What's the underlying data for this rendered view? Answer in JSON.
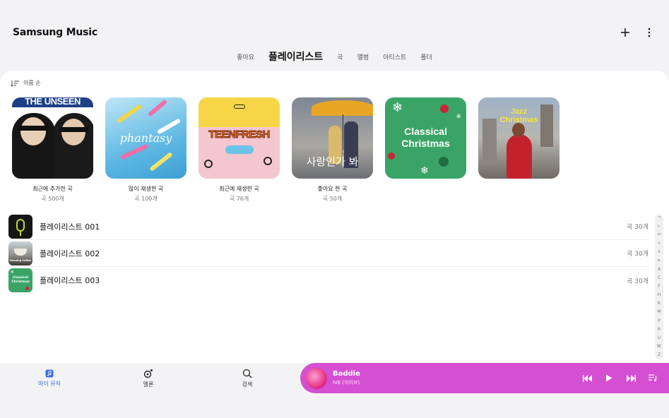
{
  "app": {
    "title": "Samsung Music"
  },
  "tabs": [
    {
      "label": "좋아요"
    },
    {
      "label": "플레이리스트",
      "active": true
    },
    {
      "label": "곡"
    },
    {
      "label": "앨범"
    },
    {
      "label": "아티스트"
    },
    {
      "label": "폴더"
    }
  ],
  "sort": {
    "label": "이름 순"
  },
  "featured": [
    {
      "title": "최근에 추가한 곡",
      "count": "곡 500개",
      "cover_text": "THE UNSEEN"
    },
    {
      "title": "많이 재생한 곡",
      "count": "곡 100개",
      "cover_text": "phantasy"
    },
    {
      "title": "최근에 재생한 곡",
      "count": "곡 76개",
      "cover_text": "TEENFRESH"
    },
    {
      "title": "좋아요 한 곡",
      "count": "곡 50개",
      "cover_text": "사랑인가 봐"
    },
    {
      "title": "",
      "count": "",
      "cover_text": "Classical Christmas"
    },
    {
      "title": "",
      "count": "",
      "cover_text": "Jazz Christmas"
    }
  ],
  "playlists": [
    {
      "title": "플레이리스트 001",
      "count": "곡 30개",
      "thumb_text": ""
    },
    {
      "title": "플레이리스트 002",
      "count": "곡 30개",
      "thumb_text": "Morning Coffee"
    },
    {
      "title": "플레이리스트 003",
      "count": "곡 30개",
      "thumb_text": "Classical Christmas"
    }
  ],
  "index_letters": [
    "ㄱ",
    "ㄴ",
    "ㅁ",
    "ㅅ",
    "ㅊ",
    "ㅌ",
    "A",
    "C",
    "F",
    "H",
    "K",
    "M",
    "P",
    "R",
    "U",
    "W",
    "Z"
  ],
  "bottom_nav": [
    {
      "label": "마이 뮤직",
      "active": true
    },
    {
      "label": "멜론"
    },
    {
      "label": "검색"
    }
  ],
  "now_playing": {
    "title": "Baddie",
    "artist": "IVE (아이브)"
  },
  "colors": {
    "accent": "#3b6fe0",
    "player": "#d54fd3"
  }
}
